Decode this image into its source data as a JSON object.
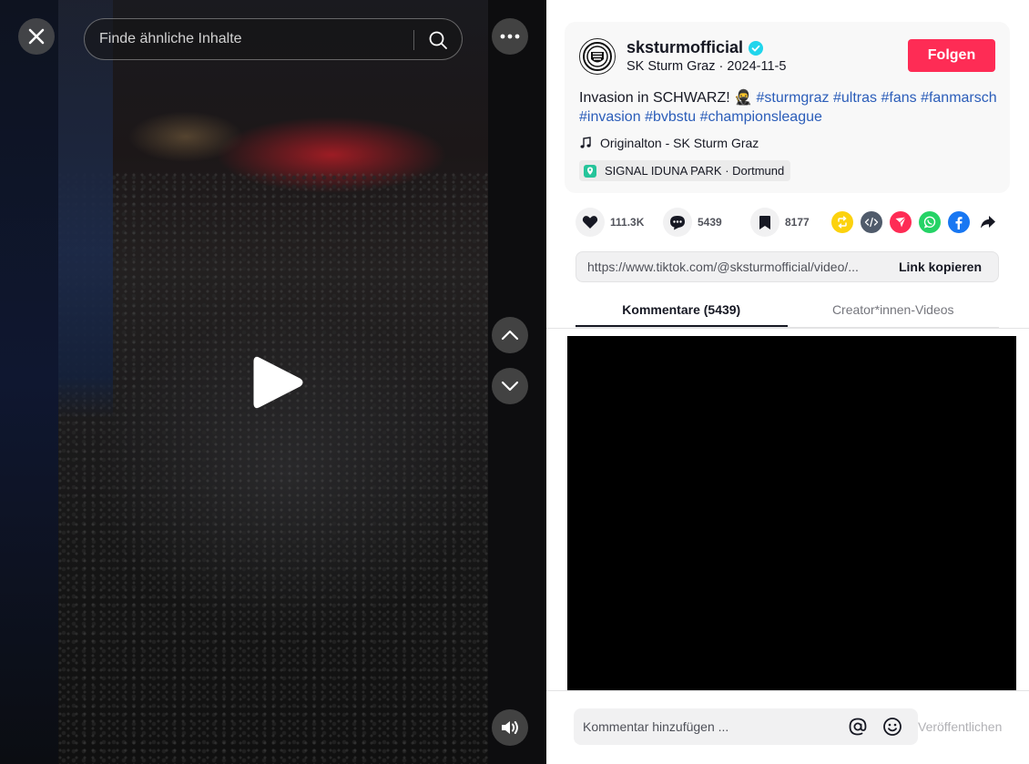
{
  "video": {
    "search_placeholder": "Finde ähnliche Inhalte",
    "icons": [
      "close-icon",
      "search-icon",
      "more-icon",
      "chevron-up-icon",
      "chevron-down-icon",
      "play-icon",
      "volume-icon"
    ]
  },
  "post": {
    "username": "sksturmofficial",
    "display_name": "SK Sturm Graz",
    "date": "2024-11-5",
    "separator": " · ",
    "follow_label": "Folgen",
    "description_text": "Invasion in SCHWARZ! 🥷",
    "hashtags": [
      "#sturmgraz",
      "#ultras",
      "#fans",
      "#fanmarsch",
      "#invasion",
      "#bvbstu",
      "#championsleague"
    ],
    "music": "Originalton - SK Sturm Graz",
    "location": "SIGNAL IDUNA PARK · Dortmund"
  },
  "stats": {
    "likes": "111.3K",
    "comments": "5439",
    "saves": "8177"
  },
  "share": {
    "link": "https://www.tiktok.com/@sksturmofficial/video/...",
    "copy_label": "Link kopieren"
  },
  "tabs": [
    {
      "label": "Kommentare (5439)",
      "active": true
    },
    {
      "label": "Creator*innen-Videos",
      "active": false
    }
  ],
  "comment_box": {
    "placeholder": "Kommentar hinzufügen ...",
    "publish_label": "Veröffentlichen"
  },
  "colors": {
    "follow": "#fe2c55",
    "hashtag": "#2b5db9",
    "verified": "#20d5ec"
  }
}
